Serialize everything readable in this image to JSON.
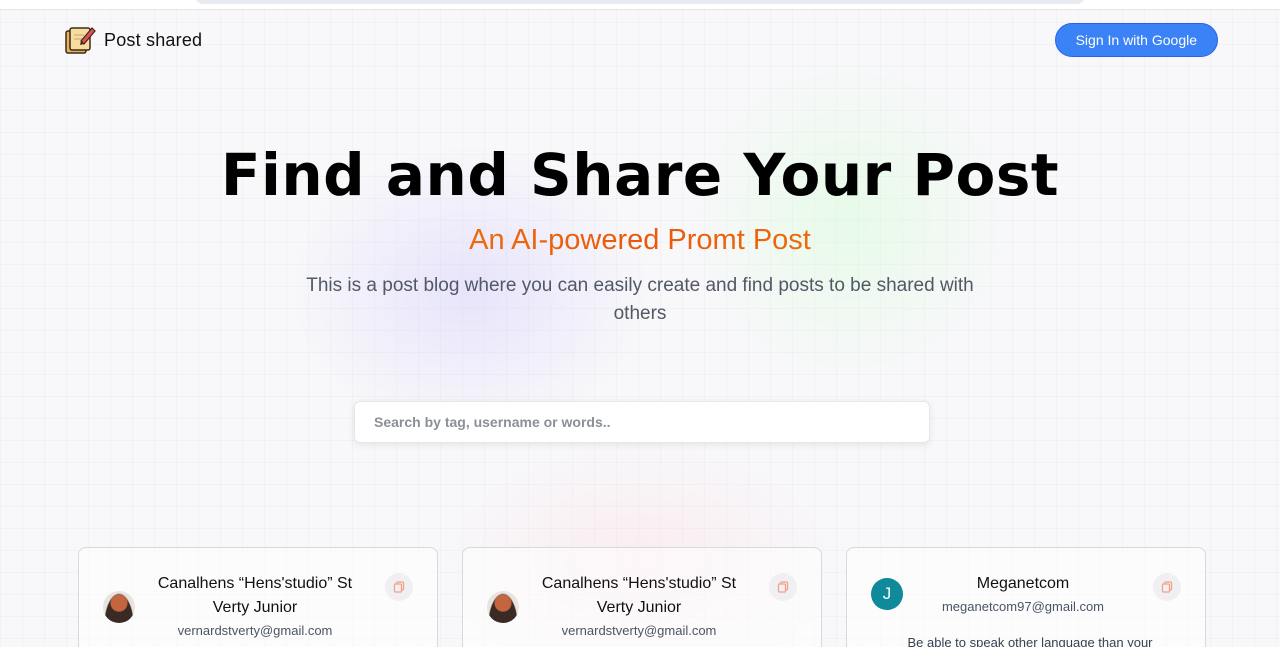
{
  "brand": {
    "name": "Post shared",
    "logo_icon": "notebook-pen-icon"
  },
  "nav": {
    "signin_label": "Sign In with Google"
  },
  "hero": {
    "title": "Find and Share Your Post",
    "subtitle": "An AI-powered Promt Post",
    "description": "This is a post blog where you can easily create and find posts to be shared with others"
  },
  "search": {
    "placeholder": "Search by tag, username or words..",
    "value": ""
  },
  "colors": {
    "accent": "#3b82f6",
    "subtitle_gradient": [
      "#f59e0b",
      "#ea580c"
    ],
    "avatar_letter_bg": "#0e8a9a"
  },
  "cards": [
    {
      "name_line1": "Canalhens “Hens'studio” St",
      "name_line2": "Verty Junior",
      "email": "vernardstverty@gmail.com",
      "avatar": "photo",
      "copy_icon": "copy-icon"
    },
    {
      "name_line1": "Canalhens “Hens'studio” St",
      "name_line2": "Verty Junior",
      "email": "vernardstverty@gmail.com",
      "avatar": "photo",
      "copy_icon": "copy-icon"
    },
    {
      "name_line1": "Meganetcom",
      "email": "meganetcom97@gmail.com",
      "avatar_letter": "J",
      "text": "Be able to speak other language than your",
      "copy_icon": "copy-icon"
    }
  ]
}
